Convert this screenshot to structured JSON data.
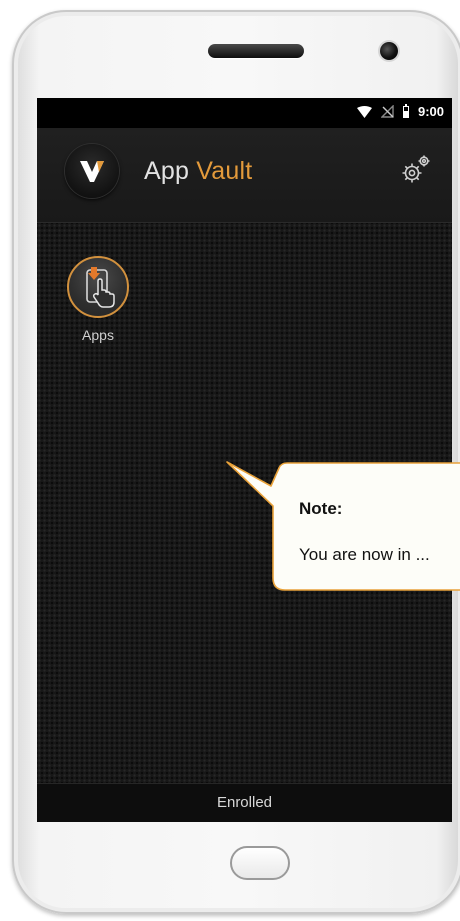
{
  "status_bar": {
    "time": "9:00"
  },
  "app_bar": {
    "title_main": "App",
    "title_accent": "Vault"
  },
  "launcher": {
    "items": [
      {
        "label": "Apps"
      }
    ]
  },
  "footer": {
    "status": "Enrolled"
  },
  "callout": {
    "title": "Note:",
    "body": "You are now in ..."
  },
  "colors": {
    "accent": "#e39a3b",
    "screen_bg": "#171717",
    "callout_bg": "#fdfdf8",
    "callout_border": "#e9a23a"
  },
  "icons": [
    "wifi-icon",
    "no-signal-icon",
    "battery-icon",
    "logo-icon",
    "settings-icon",
    "tap-download-icon"
  ]
}
